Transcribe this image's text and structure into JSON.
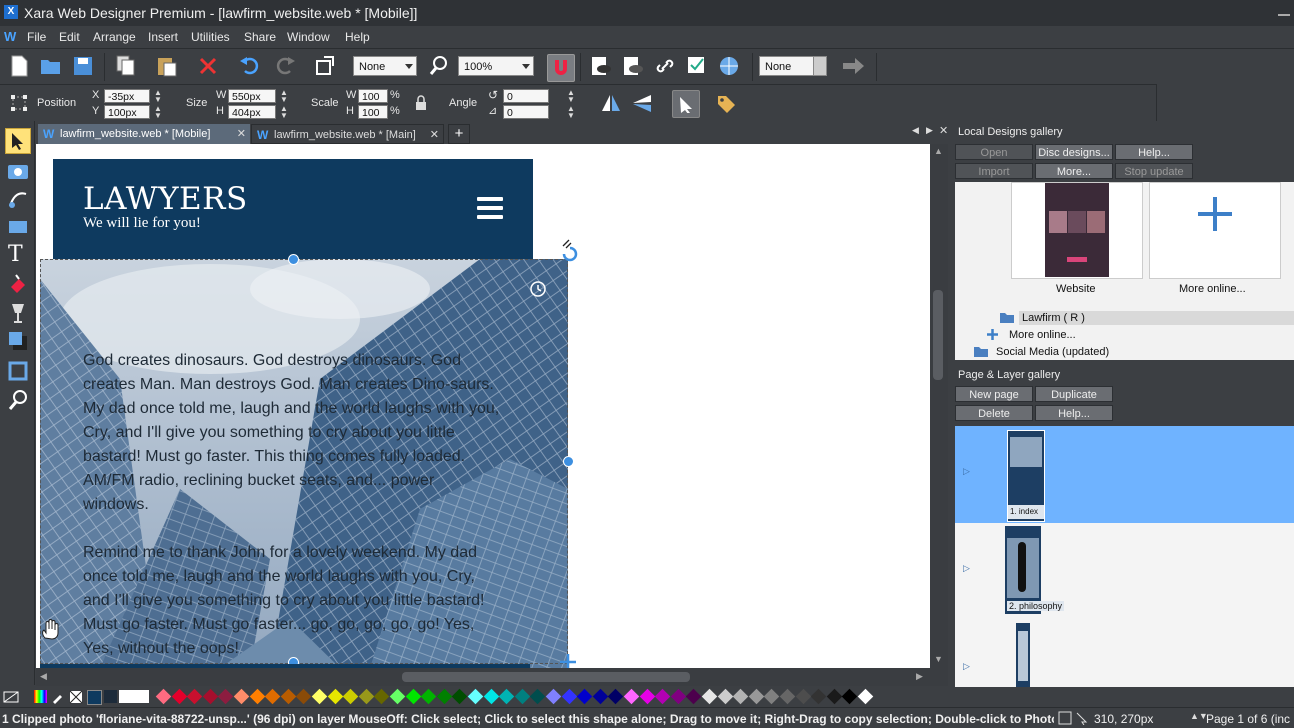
{
  "window": {
    "title": "Xara Web Designer Premium - [lawfirm_website.web * [Mobile]]"
  },
  "menu": [
    "File",
    "Edit",
    "Arrange",
    "Insert",
    "Utilities",
    "Share",
    "Window",
    "Help"
  ],
  "toolbar": {
    "blend_combo": "None",
    "zoom_combo": "100%",
    "link_combo": "None"
  },
  "infobar": {
    "position_label": "Position",
    "x_label": "X",
    "x_value": "-35px",
    "y_label": "Y",
    "y_value": "100px",
    "size_label": "Size",
    "w_label": "W",
    "w_value": "550px",
    "h_label": "H",
    "h_value": "404px",
    "scale_label": "Scale",
    "scale_w_label": "W",
    "scale_w_value": "100",
    "scale_h_label": "H",
    "scale_h_value": "100",
    "percent": "%",
    "angle_label": "Angle",
    "angle_value": "0",
    "skew_value": "0"
  },
  "tabs": [
    {
      "label": "lawfirm_website.web * [Mobile]",
      "active": true
    },
    {
      "label": "lawfirm_website.web * [Main]",
      "active": false
    }
  ],
  "canvas": {
    "site_title": "LAWYERS",
    "site_tagline": "We will lie for you!",
    "paragraph1": "God creates dinosaurs. God destroys dinosaurs. God creates Man. Man destroys God. Man creates Dino-saurs. My dad once told me, laugh and the world laughs with you, Cry, and I'll give you something to cry about you little bastard! Must go faster. This thing comes fully loaded. AM/FM radio, reclining bucket seats, and... power windows.",
    "paragraph2": "Remind me to thank John for a lovely weekend. My dad once told me, laugh and the world laughs with you, Cry, and I'll give you something to cry about you little bastard! Must go faster. Must go faster... go, go, go, go, go! Yes, Yes, without the oops!"
  },
  "designs_gallery": {
    "title": "Local Designs gallery",
    "buttons": {
      "open": "Open",
      "disc": "Disc designs...",
      "help": "Help...",
      "import": "Import",
      "more": "More...",
      "stop": "Stop update"
    },
    "thumb1_label": "Website",
    "thumb2_label": "More online...",
    "folder1": "Lawfirm ( R )",
    "more_online": "More online...",
    "folder2": "Social Media (updated)"
  },
  "page_gallery": {
    "title": "Page & Layer gallery",
    "buttons": {
      "new": "New  page",
      "duplicate": "Duplicate",
      "delete": "Delete",
      "help": "Help..."
    },
    "page1": "1. index",
    "page2": "2. philosophy"
  },
  "colors": {
    "accent": "#3d8fe0",
    "header_bg": "#0e3a5f",
    "selected_row": "#6fb3ff"
  },
  "status": {
    "message": "1 Clipped photo 'floriane-vita-88722-unsp...' (96 dpi) on layer MouseOff: Click select; Click to select this shape alone; Drag to move it; Right-Drag to copy selection; Double-click to Photo Tool; Use S",
    "coords": "310, 270px",
    "page_info": "Page 1 of 6 (inc"
  }
}
